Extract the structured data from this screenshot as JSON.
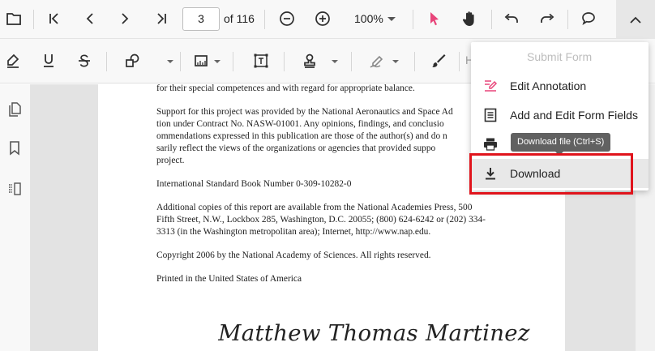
{
  "toolbar": {
    "page_number": "3",
    "page_of": "of 116",
    "zoom": "100%",
    "annotation_text_partial": "H",
    "icons": [
      "open-file-icon",
      "first-page-icon",
      "previous-page-icon",
      "next-page-icon",
      "last-page-icon",
      "zoom-out-icon",
      "zoom-in-icon",
      "zoom-dropdown-icon",
      "selection-pointer-icon",
      "pan-hand-icon",
      "undo-icon",
      "redo-icon",
      "comment-icon",
      "collapse-chevron-up-icon",
      "highlight-pen-icon",
      "underline-icon",
      "strikethrough-icon",
      "shapes-icon",
      "calibrate-icon",
      "free-text-icon",
      "stamp-icon",
      "signature-icon",
      "ink-brush-icon"
    ]
  },
  "sidebar": {
    "icons": [
      "page-thumbnails-icon",
      "bookmarks-icon",
      "organize-pages-icon"
    ]
  },
  "document": {
    "lines": [
      "for their special competences and with regard for appropriate balance.",
      "Support for this project was provided by the National Aeronautics and Space Ad",
      "tion under Contract No. NASW-01001. Any opinions, findings, and conclusio",
      "ommendations expressed in this publication are those of the author(s) and do n",
      "sarily reflect the views of the organizations or agencies that provided suppo",
      "project.",
      "International Standard Book Number 0-309-10282-0",
      "Additional copies of this report are available from the National Academies Press, 500",
      "Fifth Street, N.W., Lockbox 285, Washington, D.C. 20055; (800) 624-6242 or (202) 334-",
      "3313 (in the Washington metropolitan area); Internet, http://www.nap.edu.",
      "Copyright 2006 by the National Academy of Sciences. All rights reserved.",
      "Printed in the United States of America"
    ],
    "signature": "Matthew Thomas Martinez"
  },
  "menu": {
    "submit_form": "Submit Form",
    "edit_annotation": "Edit Annotation",
    "add_edit_form_fields": "Add and Edit Form Fields",
    "download": "Download",
    "print_icon": "print-icon"
  },
  "tooltip": "Download file (Ctrl+S)",
  "colors": {
    "accent_pink": "#e8457a",
    "highlight_red": "#e0141c",
    "tooltip_bg": "#616161"
  }
}
